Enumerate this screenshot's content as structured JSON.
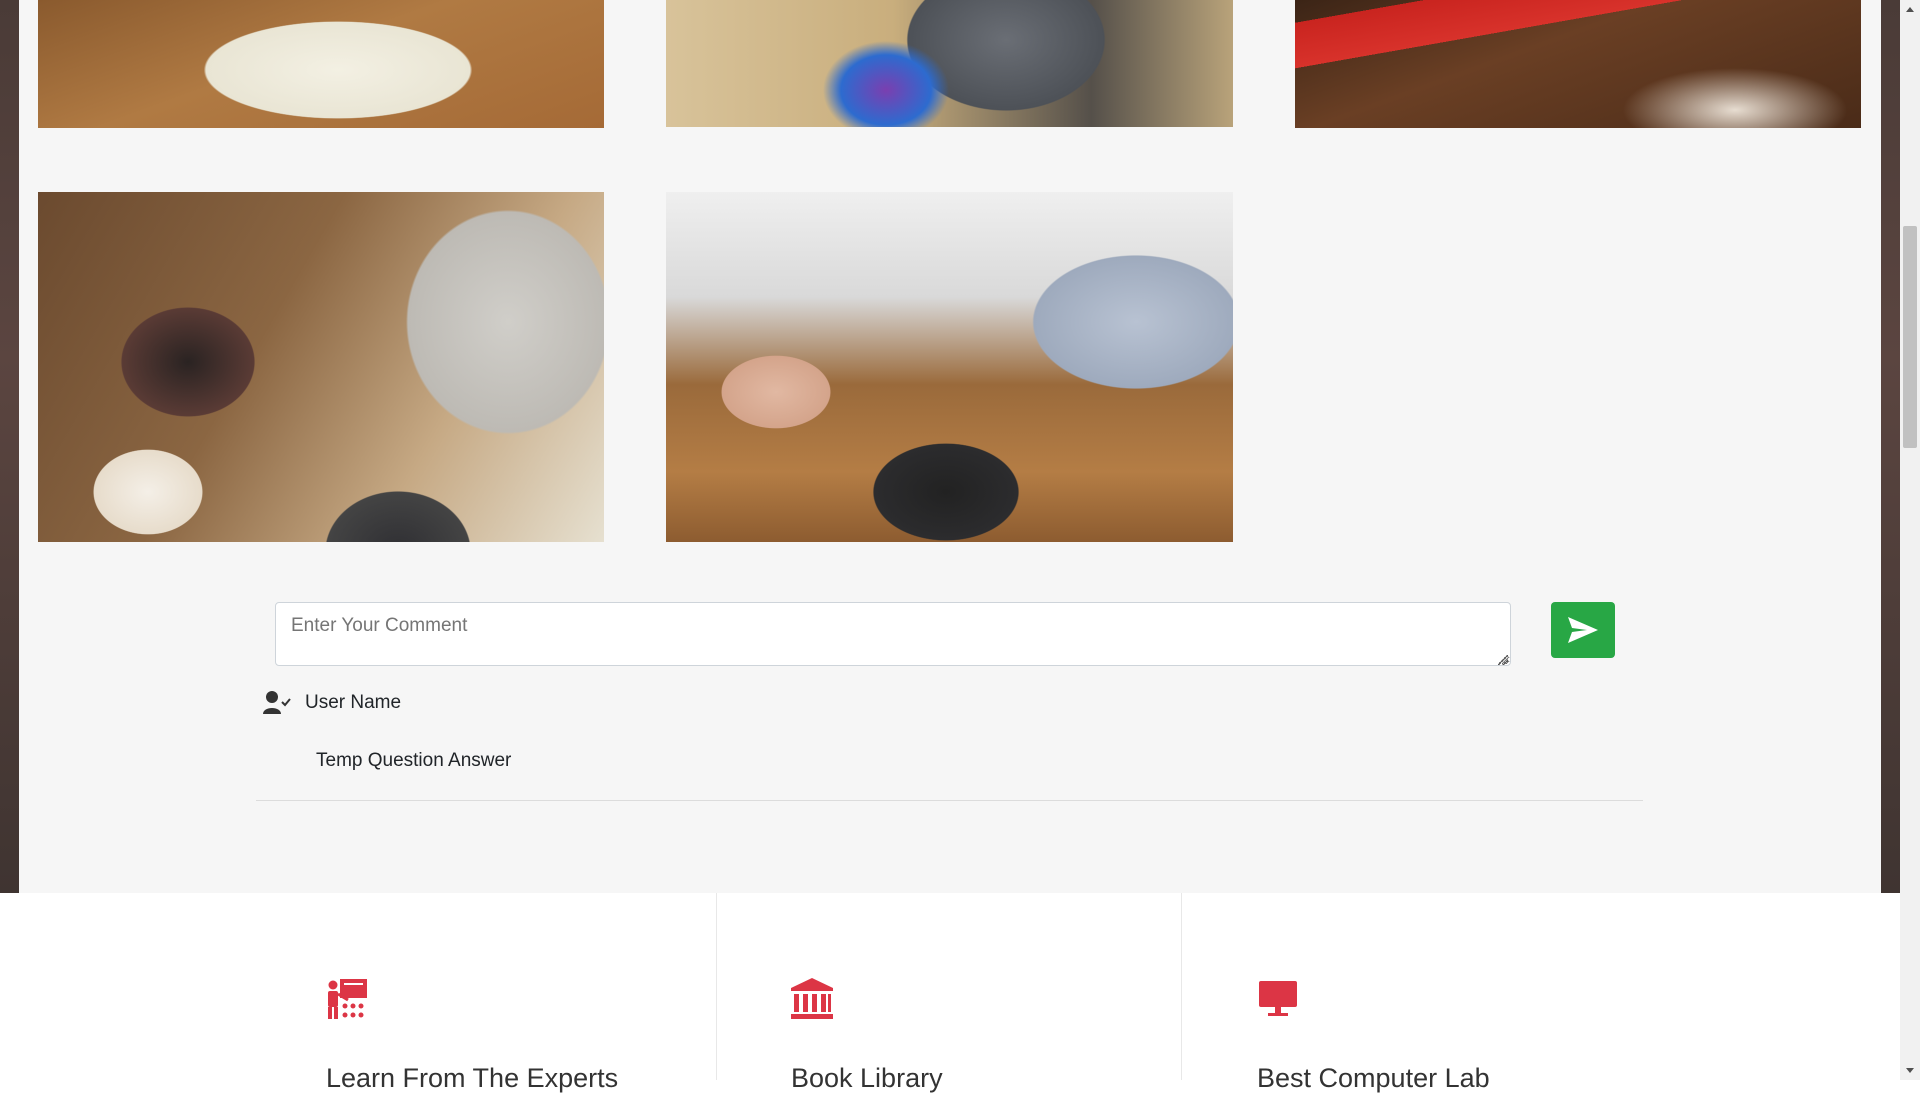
{
  "gallery": {
    "images": [
      {
        "name": "notebook-desk-photo"
      },
      {
        "name": "man-desk-pens-photo"
      },
      {
        "name": "red-notebook-laptop-photo"
      },
      {
        "name": "woman-laptop-cafe-photo"
      },
      {
        "name": "laptop-desk-phone-photo"
      }
    ]
  },
  "comment": {
    "placeholder": "Enter Your Comment",
    "value": ""
  },
  "send": {
    "icon": "send-icon",
    "color": "#28a745"
  },
  "thread": {
    "user_icon": "user-check-icon",
    "user_name": "User Name",
    "answer": "Temp Question Answer"
  },
  "features": {
    "accent_color": "#dc3545",
    "items": [
      {
        "icon": "teacher-icon",
        "title": "Learn From The Experts"
      },
      {
        "icon": "library-icon",
        "title": "Book Library"
      },
      {
        "icon": "monitor-icon",
        "title": "Best Computer Lab"
      }
    ]
  }
}
